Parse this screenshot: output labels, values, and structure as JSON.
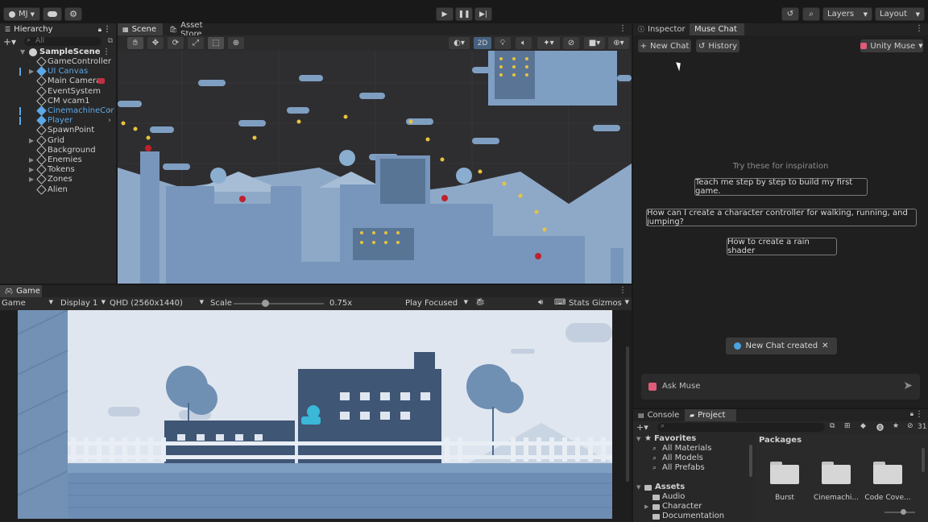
{
  "toolbar": {
    "account": "MJ",
    "layers": "Layers",
    "layout": "Layout"
  },
  "hierarchy": {
    "tab": "Hierarchy",
    "search_placeholder": "All",
    "scene": "SampleScene",
    "items": [
      {
        "label": "GameController",
        "expandable": false,
        "blue": false
      },
      {
        "label": "UI Canvas",
        "expandable": true,
        "blue": true
      },
      {
        "label": "Main Camera",
        "expandable": false,
        "blue": false
      },
      {
        "label": "EventSystem",
        "expandable": false,
        "blue": false
      },
      {
        "label": "CM vcam1",
        "expandable": false,
        "blue": false
      },
      {
        "label": "CinemachineCor",
        "expandable": false,
        "blue": true
      },
      {
        "label": "Player",
        "expandable": false,
        "blue": true
      },
      {
        "label": "SpawnPoint",
        "expandable": false,
        "blue": false
      },
      {
        "label": "Grid",
        "expandable": true,
        "blue": false
      },
      {
        "label": "Background",
        "expandable": false,
        "blue": false
      },
      {
        "label": "Enemies",
        "expandable": true,
        "blue": false
      },
      {
        "label": "Tokens",
        "expandable": true,
        "blue": false
      },
      {
        "label": "Zones",
        "expandable": true,
        "blue": false
      },
      {
        "label": "Alien",
        "expandable": false,
        "blue": false
      }
    ]
  },
  "scene_view": {
    "tab_scene": "Scene",
    "tab_asset_store": "Asset Store",
    "mode_2d": "2D"
  },
  "game_view": {
    "tab": "Game",
    "mode": "Game",
    "display": "Display 1",
    "resolution": "QHD (2560x1440)",
    "scale_label": "Scale",
    "scale_value": "0.75x",
    "play_mode": "Play Focused",
    "stats": "Stats",
    "gizmos": "Gizmos",
    "scale_fraction": 0.35
  },
  "muse": {
    "tab_inspector": "Inspector",
    "tab_muse": "Muse Chat",
    "new_chat": "New Chat",
    "history": "History",
    "unity_muse": "Unity Muse",
    "inspiration_title": "Try these for inspiration",
    "suggestions": [
      "Teach me step by step to build my first game.",
      "How can I create a character controller for walking, running, and jumping?",
      "How to create a rain shader"
    ],
    "toast": "New Chat created",
    "ask_placeholder": "Ask Muse"
  },
  "project": {
    "tab_console": "Console",
    "tab_project": "Project",
    "count": "31",
    "favorites": "Favorites",
    "favorite_items": [
      "All Materials",
      "All Models",
      "All Prefabs"
    ],
    "assets": "Assets",
    "asset_items": [
      "Audio",
      "Character",
      "Documentation"
    ],
    "breadcrumb": "Packages",
    "packages": [
      "Burst",
      "Cinemachi...",
      "Code Cove..."
    ]
  },
  "colors": {
    "accent_blue": "#5ca7e6",
    "scene_sky": "#2d2d2f",
    "tile_blue": "#7f9fc2",
    "game_sky": "#dfe6ef"
  }
}
